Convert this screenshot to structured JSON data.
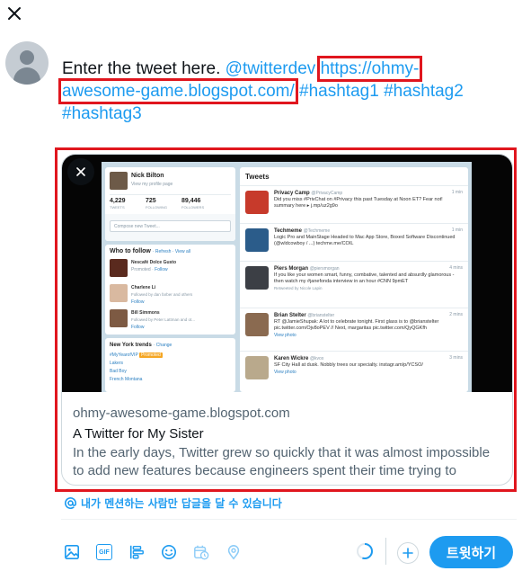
{
  "composer": {
    "text_plain": "Enter the tweet here. ",
    "mention": "@twitterdev",
    "url_part1": "https://ohmy-",
    "url_part2": "awesome-game.blogspot.com/",
    "hashtag1": "#hashtag1",
    "hashtag2": "#hashtag2",
    "hashtag3": "#hashtag3"
  },
  "card": {
    "domain": "ohmy-awesome-game.blogspot.com",
    "title": "A Twitter for My Sister",
    "description": "In the early days, Twitter grew so quickly that it was almost impossible to add new features because engineers spent their time trying to keep…"
  },
  "preview": {
    "profile_name": "Nick Bilton",
    "profile_sub": "View my profile page",
    "stats": [
      {
        "value": "4,229",
        "label": "TWEETS"
      },
      {
        "value": "725",
        "label": "FOLLOWING"
      },
      {
        "value": "89,446",
        "label": "FOLLOWERS"
      }
    ],
    "compose_placeholder": "Compose new Tweet...",
    "who_to_follow": "Who to follow",
    "who_links": "· Refresh · View all",
    "follow_suggestions": [
      {
        "name": "Nescafé Dolce Gusto",
        "handle": "@Dolce...",
        "sub": "Promoted",
        "action": "Follow"
      },
      {
        "name": "Charlene Li",
        "handle": "@charleneli",
        "sub": "Followed by dan farber and others",
        "action": "Follow"
      },
      {
        "name": "Bill Simmons",
        "handle": "@sportsguy33",
        "sub": "Followed by Peter Lattman and ot...",
        "action": "Follow"
      }
    ],
    "trends_title": "New York trends",
    "trends_change": "· Change",
    "trends": [
      "#MyYearofVIP",
      "Lakers",
      "Bad Boy",
      "French Montana"
    ],
    "trends_promoted": "Promoted",
    "tweets_header": "Tweets",
    "tweets": [
      {
        "name": "Privacy Camp",
        "handle": "@PrivacyCamp",
        "time": "1 min",
        "text": "Did you miss #PrivChat on #Privacy this past Tuesday at Noon ET? Fear not! summary here ▸ j.mp/uz2g9o"
      },
      {
        "name": "Techmeme",
        "handle": "@Techmeme",
        "time": "1 min",
        "text": "Logic Pro and MainStage Headed to Mac App Store, Boxed Software Discontinued (@wldcowboy / ...) techme.me/COIL"
      },
      {
        "name": "Piers Morgan",
        "handle": "@piersmorgan",
        "time": "4 mins",
        "text": "If you like your women smart, funny, combative, talented and absurdly glamorous - then watch my #janefonda interview in an hour #CNN 9pmET"
      },
      {
        "name": "Brian Stelter",
        "handle": "@brianstelter",
        "time": "2 mins",
        "text": "RT @JamieShupak: A lot to celebrate tonight. First glass is to @brianstelter pic.twitter.com/Ojv8oPEV // Next, margaritas pic.twitter.com/QyQGKfh"
      },
      {
        "name": "Karen Wickre",
        "handle": "@kvox",
        "time": "3 mins",
        "text": "SF City Hall at dusk. Nobbly trees our specialty. instagr.am/p/YCSO/"
      }
    ],
    "retweeted_by": "Retweeted by Nicole Lapin",
    "view_photo": "View photo"
  },
  "reply_setting": "내가 멘션하는 사람만 답글을 달 수 있습니다",
  "toolbar": {
    "icons": [
      "media-icon",
      "gif-icon",
      "poll-icon",
      "emoji-icon",
      "schedule-icon",
      "location-icon"
    ],
    "gif_label": "GIF"
  },
  "tweet_button": "트윗하기",
  "colors": {
    "accent": "#1d9bf0",
    "highlight": "#e0161e",
    "text": "#0f1419",
    "muted": "#536471"
  },
  "char_progress": 0.55
}
